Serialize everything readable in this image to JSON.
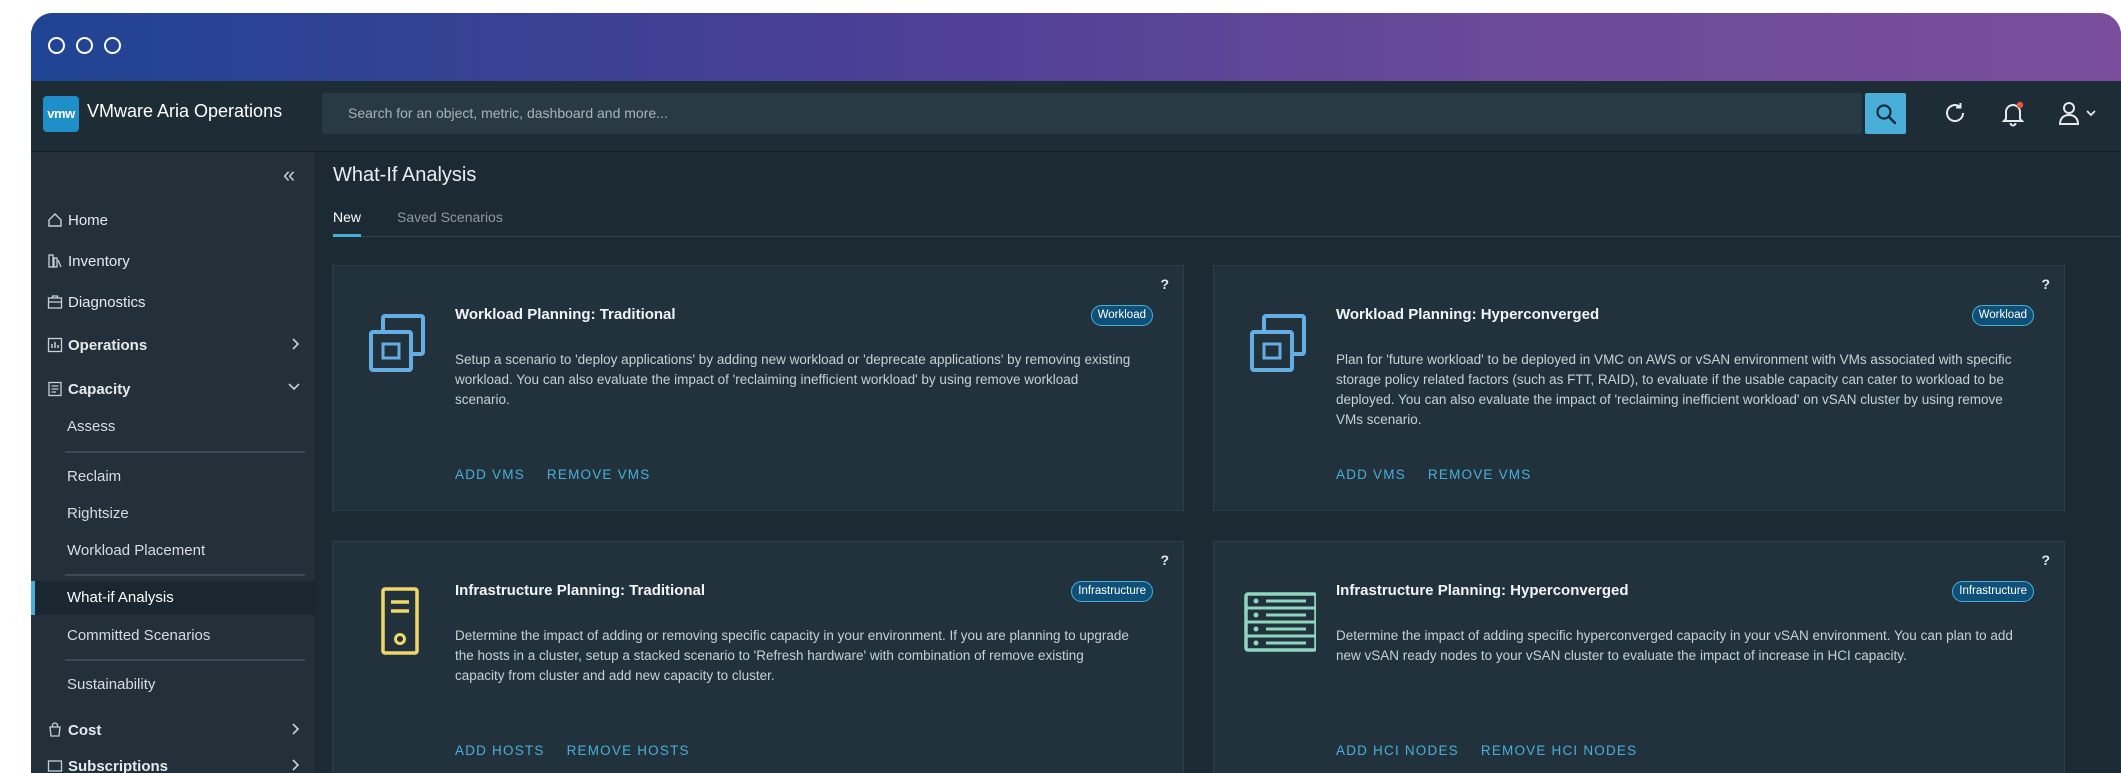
{
  "app": {
    "logo_text": "vmw",
    "product_name": "VMware Aria Operations",
    "search_placeholder": "Search for an object, metric, dashboard and more..."
  },
  "colors": {
    "accent": "#49afd9",
    "titlebar_gradient": [
      "#1f4493",
      "#7a4e9c"
    ],
    "background": "#1b2a33",
    "sidebar": "#233039",
    "card": "#22323c",
    "badge_bg": "#0f5078",
    "icon_blue": "#64aee3",
    "icon_yellow": "#f1d76a",
    "icon_green": "#8fd6c0",
    "notification_dot": "#e8553f"
  },
  "header_icons": [
    "search-icon",
    "refresh-icon",
    "bell-icon",
    "user-icon",
    "chevron-down-icon"
  ],
  "sidebar": {
    "collapse_icon": "double-chevron-left-icon",
    "items": [
      {
        "label": "Home",
        "icon": "home-icon"
      },
      {
        "label": "Inventory",
        "icon": "inventory-icon"
      },
      {
        "label": "Diagnostics",
        "icon": "diagnostics-icon"
      },
      {
        "label": "Operations",
        "icon": "operations-icon",
        "expandable": true
      },
      {
        "label": "Capacity",
        "icon": "capacity-icon",
        "expanded": true
      },
      {
        "label": "Cost",
        "icon": "cost-icon",
        "expandable": true
      },
      {
        "label": "Subscriptions",
        "icon": "subscriptions-icon",
        "expandable": true
      }
    ],
    "capacity_sub": [
      "Assess",
      "Reclaim",
      "Rightsize",
      "Workload Placement",
      "What-if Analysis",
      "Committed Scenarios",
      "Sustainability"
    ],
    "active_sub": "What-if Analysis"
  },
  "main": {
    "title": "What-If Analysis",
    "tabs": [
      {
        "label": "New",
        "active": true
      },
      {
        "label": "Saved Scenarios",
        "active": false
      }
    ],
    "cards": [
      {
        "title": "Workload Planning: Traditional",
        "badge": "Workload",
        "icon": "vm-copy-icon",
        "description": "Setup a scenario to 'deploy applications' by adding new workload or 'deprecate applications' by removing existing workload. You can also evaluate the impact of 'reclaiming inefficient workload' by using remove workload scenario.",
        "actions": [
          "ADD VMS",
          "REMOVE VMS"
        ],
        "help": "?"
      },
      {
        "title": "Workload Planning: Hyperconverged",
        "badge": "Workload",
        "icon": "vm-copy-icon",
        "description": "Plan for 'future workload' to be deployed in VMC on AWS or vSAN environment with VMs associated with specific storage policy related factors (such as FTT, RAID), to evaluate if the usable capacity can cater to workload to be deployed. You can also evaluate the impact of 'reclaiming inefficient workload' on vSAN cluster by using remove VMs scenario.",
        "actions": [
          "ADD VMS",
          "REMOVE VMS"
        ],
        "help": "?"
      },
      {
        "title": "Infrastructure Planning: Traditional",
        "badge": "Infrastructure",
        "icon": "host-icon",
        "description": "Determine the impact of adding or removing specific capacity in your environment. If you are planning to upgrade the hosts in a cluster, setup a stacked scenario to 'Refresh hardware' with combination of remove existing capacity from cluster and add new capacity to cluster.",
        "actions": [
          "ADD HOSTS",
          "REMOVE HOSTS"
        ],
        "help": "?"
      },
      {
        "title": "Infrastructure Planning: Hyperconverged",
        "badge": "Infrastructure",
        "icon": "hci-rack-icon",
        "description": "Determine the impact of adding specific hyperconverged capacity in your vSAN environment. You can plan to add new vSAN ready nodes to your vSAN cluster to evaluate the impact of increase in HCI capacity.",
        "actions": [
          "ADD HCI NODES",
          "REMOVE HCI NODES"
        ],
        "help": "?"
      }
    ]
  }
}
